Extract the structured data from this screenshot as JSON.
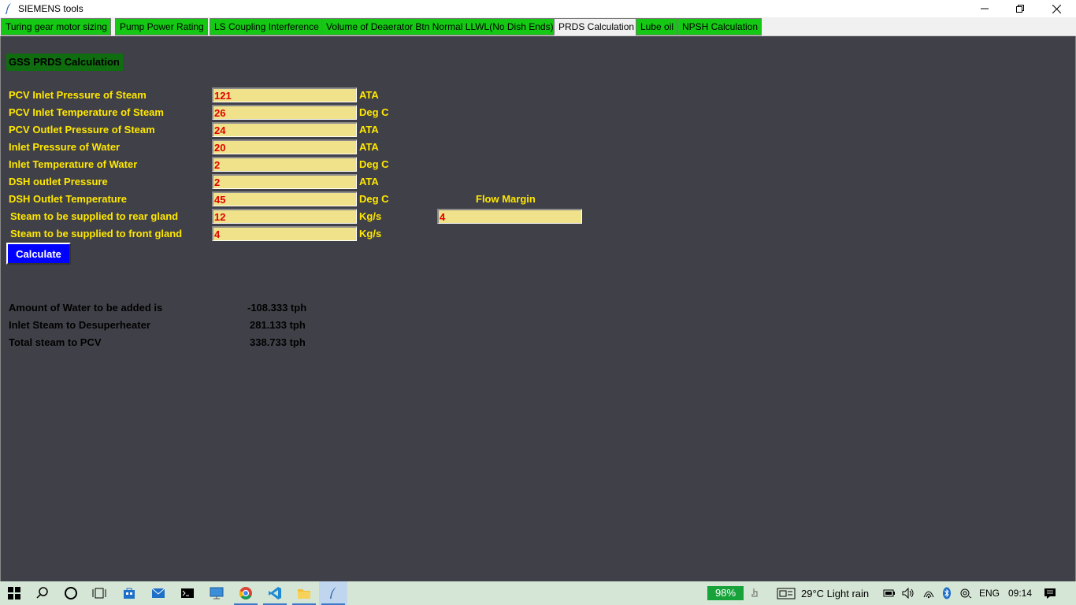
{
  "window": {
    "title": "SIEMENS tools"
  },
  "tabs": [
    {
      "label": "Turing gear motor sizing"
    },
    {
      "label": "Pump Power Rating"
    },
    {
      "label": "LS Coupling Interference"
    },
    {
      "label": "Volume of Deaerator Btn Normal LLWL(No Dish Ends)"
    },
    {
      "label": "PRDS Calculation"
    },
    {
      "label": "Lube oil"
    },
    {
      "label": "NPSH Calculation"
    }
  ],
  "form": {
    "title": "GSS PRDS Calculation",
    "fields": [
      {
        "label": "PCV Inlet Pressure of Steam",
        "value": "121",
        "unit": "ATA"
      },
      {
        "label": "PCV Inlet Temperature of Steam",
        "value": "26",
        "unit": "Deg C"
      },
      {
        "label": "PCV Outlet Pressure of Steam",
        "value": "24",
        "unit": "ATA"
      },
      {
        "label": "Inlet Pressure of Water",
        "value": "20",
        "unit": "ATA"
      },
      {
        "label": "Inlet Temperature of Water",
        "value": "2",
        "unit": "Deg C"
      },
      {
        "label": "DSH outlet Pressure",
        "value": "2",
        "unit": "ATA"
      },
      {
        "label": "DSH Outlet Temperature",
        "value": "45",
        "unit": "Deg C"
      },
      {
        "label": "Steam to be supplied to rear gland",
        "value": "12",
        "unit": "Kg/s"
      },
      {
        "label": "Steam to be supplied to front gland",
        "value": "4",
        "unit": "Kg/s"
      }
    ],
    "flow_margin": {
      "label": "Flow Margin",
      "value": "4"
    },
    "calculate_label": "Calculate"
  },
  "results": [
    {
      "label": "Amount of Water to be added is",
      "value": "-108.333 tph"
    },
    {
      "label": "Inlet Steam to Desuperheater",
      "value": "281.133 tph"
    },
    {
      "label": "Total steam to PCV",
      "value": "338.733 tph"
    }
  ],
  "taskbar": {
    "battery": "98%",
    "weather": "29°C  Light rain",
    "language": "ENG",
    "time": "09:14"
  },
  "colors": {
    "tab_green": "#14c814",
    "panel_bg": "#404048",
    "label_yellow": "#ffe800",
    "field_bg": "#efe28a",
    "field_text": "#e00000",
    "button_blue": "#0000ff",
    "section_green": "#0f6d0f"
  }
}
